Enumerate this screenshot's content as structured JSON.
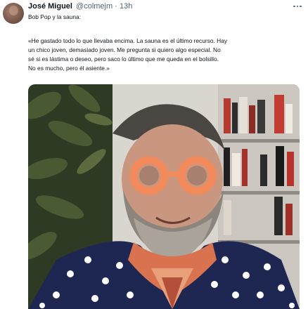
{
  "tweet": {
    "author_name": "José Miguel",
    "handle": "@colmejm",
    "separator": "·",
    "time": "13h",
    "lines": [
      "Bob Pop y la sauna:",
      "«He gastado todo lo que llevaba encima. La sauna es el último recurso. Hay",
      "un chico joven, demasiado joven. Me pregunta si quiero algo especial. No",
      "sé si es lástima o deseo, pero saco lo último que me queda en el bolsillo.",
      "No es mucho, pero él asiente.»"
    ]
  },
  "icons": {
    "more": "more-horizontal-icon"
  },
  "colors": {
    "text": "#0f1419",
    "secondary": "#536471",
    "glasses": "#f28a5c",
    "shirt": "#1e2752"
  }
}
